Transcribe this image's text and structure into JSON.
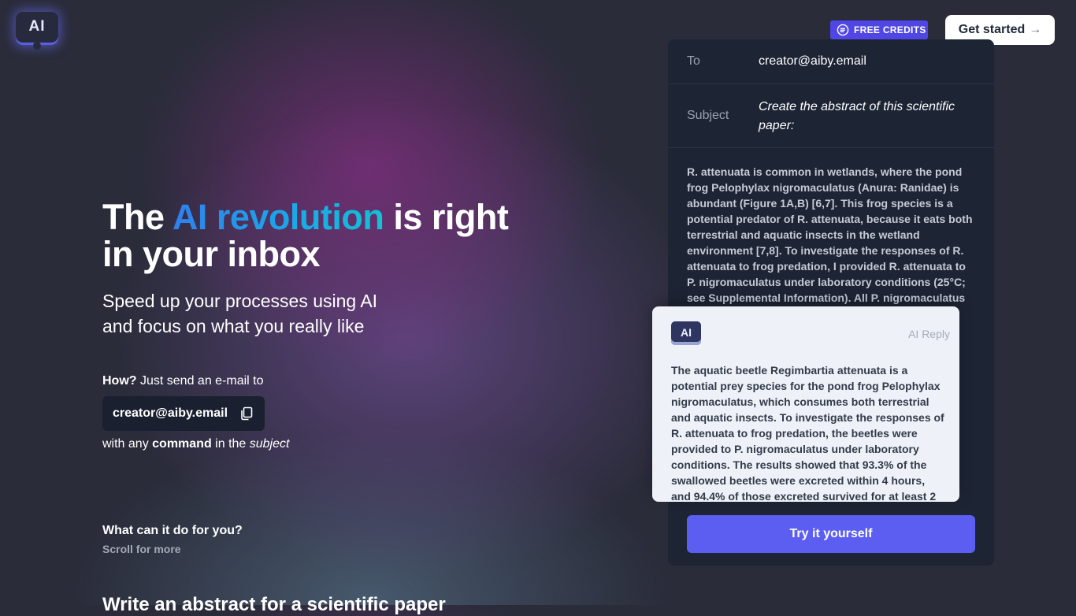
{
  "brand": {
    "logo_text": "AI"
  },
  "header": {
    "credits_label": "FREE CREDITS",
    "get_started_label": "Get started",
    "get_started_arrow": "→"
  },
  "hero": {
    "title_prefix": "The ",
    "title_highlight": "AI revolution",
    "title_suffix": " is right in your inbox",
    "subtitle": "Speed up your processes using AI and focus on what you really like",
    "how_bold": "How?",
    "how_text": " Just send an e-mail to",
    "email": "creator@aiby.email",
    "with_any": "with any ",
    "command": "command",
    "in_the": " in the ",
    "subject_word": "subject"
  },
  "features": {
    "question": "What can it do for you?",
    "scroll_hint": "Scroll for more",
    "first_heading": "Write an abstract for a scientific paper"
  },
  "email_preview": {
    "to_label": "To",
    "to_value": "creator@aiby.email",
    "subject_label": "Subject",
    "subject_value": "Create the abstract of this scientific paper:",
    "body": "R. attenuata is common in wetlands, where the pond frog Pelophylax nigromaculatus (Anura: Ranidae) is abundant (Figure 1A,B) [6,7]. This frog species is a potential predator of R. attenuata, because it eats both terrestrial and aquatic insects in the wetland environment [7,8]. To investigate the responses of R. attenuata to frog predation, I provided R. attenuata to P. nigromaculatus under laboratory conditions (25°C; see Supplemental Information). All P. nigromaculatus",
    "try_label": "Try it yourself"
  },
  "ai_reply": {
    "avatar_text": "AI",
    "label": "AI Reply",
    "body": "The aquatic beetle Regimbartia attenuata is a potential prey species for the pond frog Pelophylax nigromaculatus, which consumes both terrestrial and aquatic insects. To investigate the responses of R. attenuata to frog predation, the beetles were provided to P. nigromaculatus under laboratory conditions. The results showed that 93.3% of the swallowed beetles were excreted within 4 hours, and 94.4% of those excreted survived for at least 2"
  },
  "icons": {
    "credits": "coin-stack-icon",
    "copy": "copy-icon"
  },
  "colors": {
    "accent": "#5b5ef0",
    "credits_badge": "#4f46e5",
    "panel": "#1d2434",
    "reply_card": "#eef2f8"
  }
}
